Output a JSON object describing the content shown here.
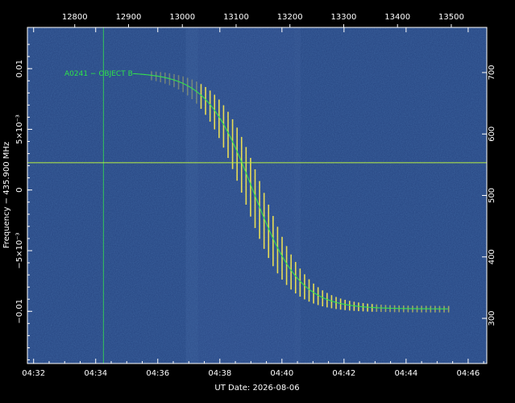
{
  "chart_data": {
    "type": "heatmap",
    "title": "",
    "xlabel": "UT Date: 2026-08-06",
    "ylabel": "Frequency − 435.900 MHz",
    "bottom_axis": {
      "range_minutes": [
        271.8,
        286.6
      ],
      "ticks": [
        {
          "value": 272,
          "label": "04:32"
        },
        {
          "value": 274,
          "label": "04:34"
        },
        {
          "value": 276,
          "label": "04:36"
        },
        {
          "value": 278,
          "label": "04:38"
        },
        {
          "value": 280,
          "label": "04:40"
        },
        {
          "value": 282,
          "label": "04:42"
        },
        {
          "value": 284,
          "label": "04:44"
        },
        {
          "value": 286,
          "label": "04:46"
        }
      ]
    },
    "top_axis": {
      "ticks": [
        {
          "value": 12800,
          "label": "12800"
        },
        {
          "value": 12900,
          "label": "12900"
        },
        {
          "value": 13000,
          "label": "13000"
        },
        {
          "value": 13100,
          "label": "13100"
        },
        {
          "value": 13200,
          "label": "13200"
        },
        {
          "value": 13300,
          "label": "13300"
        },
        {
          "value": 13400,
          "label": "13400"
        },
        {
          "value": 13500,
          "label": "13500"
        }
      ]
    },
    "left_axis": {
      "range": [
        -0.0143,
        0.0134
      ],
      "ticks": [
        {
          "value": 0.01,
          "label": "0.01"
        },
        {
          "value": 0.005,
          "label": "5×10⁻³"
        },
        {
          "value": 0,
          "label": "0"
        },
        {
          "value": -0.005,
          "label": "−5×10⁻³"
        },
        {
          "value": -0.01,
          "label": "−0.01"
        }
      ]
    },
    "right_axis": {
      "ticks": [
        {
          "value": 700,
          "label": "700"
        },
        {
          "value": 600,
          "label": "600"
        },
        {
          "value": 500,
          "label": "500"
        },
        {
          "value": 400,
          "label": "400"
        },
        {
          "value": 300,
          "label": "300"
        }
      ]
    },
    "annotation": "A0241 − OBJECT B",
    "vertical_marker_minutes": 274.25,
    "horizontal_marker_value": 0.00225,
    "doppler_curve": {
      "center_minutes": 279.07,
      "high_value": 0.0097,
      "low_value": -0.0098,
      "scale_minutes": 0.75,
      "start_minutes": 275.2,
      "end_minutes": 285.4
    },
    "colors": {
      "background": "#2a4a86",
      "signal": "#e8dc55",
      "curve": "#35e04d",
      "marker": "#b8f040"
    }
  }
}
